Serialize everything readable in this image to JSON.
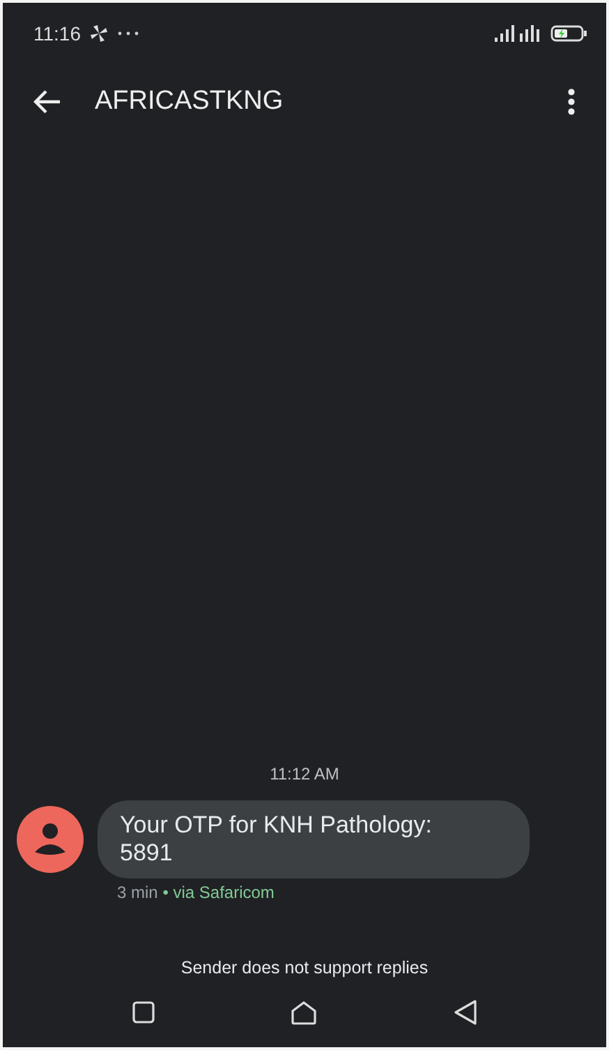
{
  "status_bar": {
    "time": "11:16"
  },
  "header": {
    "title": "AFRICASTKNG"
  },
  "conversation": {
    "timestamp": "11:12 AM",
    "messages": [
      {
        "text": "Your OTP for KNH Pathology:\n5891",
        "age": "3 min",
        "via": "• via Safaricom"
      }
    ]
  },
  "footer_note": "Sender does not support replies"
}
